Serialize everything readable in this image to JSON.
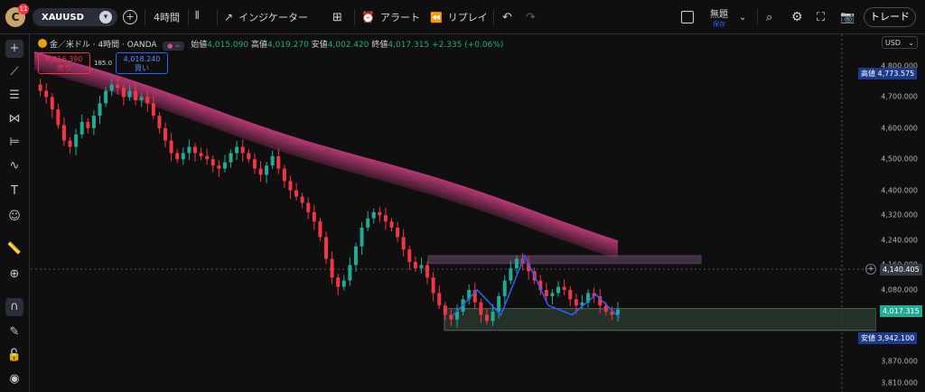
{
  "header": {
    "avatar_letter": "C",
    "notification_count": "11",
    "symbol": "XAUUSD",
    "interval": "4時間",
    "indicators_label": "インジケーター",
    "alert_label": "アラート",
    "replay_label": "リプレイ",
    "layout_name": "無題",
    "layout_status": "保存",
    "trade_button": "トレード"
  },
  "legend": {
    "title": "金／米ドル · 4時間 · OANDA",
    "open_label": "始値",
    "open": "4,015.090",
    "high_label": "高値",
    "high": "4,019.270",
    "low_label": "安値",
    "low": "4,002.420",
    "close_label": "終値",
    "close": "4,017.315",
    "change": "+2.335 (+0.06%)"
  },
  "order": {
    "sell_price": "4,016.390",
    "sell_label": "売り",
    "spread": "185.0",
    "buy_price": "4,018.240",
    "buy_label": "買い"
  },
  "axis": {
    "currency": "USD",
    "ticks": [
      "4,800.000",
      "4,700.000",
      "4,600.000",
      "4,500.000",
      "4,400.000",
      "4,320.000",
      "4,240.000",
      "4,160.000",
      "4,080.000",
      "3,870.000",
      "3,810.000"
    ],
    "high_label": "高値",
    "high_value": "4,773.575",
    "crosshair_value": "4,140.405",
    "last_value": "4,017.315",
    "low_label": "安値",
    "low_value": "3,942.100"
  },
  "colors": {
    "up": "#22ab94",
    "down": "#f23645",
    "ribbon": "#e0458f",
    "zone_fill": "#2a3a30",
    "pattern_line": "#2962ff"
  },
  "chart_data": {
    "type": "candlestick",
    "title": "金／米ドル · 4時間 · OANDA",
    "ylim": [
      3780,
      4830
    ],
    "close_series": [
      4740,
      4720,
      4700,
      4660,
      4610,
      4560,
      4540,
      4580,
      4620,
      4600,
      4640,
      4680,
      4720,
      4740,
      4730,
      4700,
      4720,
      4690,
      4700,
      4680,
      4640,
      4600,
      4560,
      4520,
      4500,
      4520,
      4540,
      4520,
      4510,
      4500,
      4480,
      4470,
      4490,
      4520,
      4540,
      4520,
      4500,
      4470,
      4450,
      4480,
      4510,
      4470,
      4430,
      4400,
      4380,
      4360,
      4330,
      4300,
      4250,
      4180,
      4120,
      4090,
      4110,
      4160,
      4220,
      4280,
      4310,
      4330,
      4320,
      4300,
      4280,
      4250,
      4210,
      4170,
      4150,
      4160,
      4120,
      4070,
      4030,
      4000,
      3985,
      4010,
      4050,
      4080,
      4040,
      4000,
      3980,
      4010,
      4060,
      4110,
      4150,
      4180,
      4165,
      4140,
      4110,
      4080,
      4060,
      4070,
      4090,
      4080,
      4050,
      4030,
      4040,
      4070,
      4060,
      4030,
      4010,
      4000,
      4017
    ],
    "resistance_zone": [
      4165,
      4190
    ],
    "support_zone": [
      3950,
      4020
    ],
    "pattern_points": [
      4000,
      4080,
      4000,
      4190,
      4030,
      4000,
      4065,
      3990
    ]
  }
}
